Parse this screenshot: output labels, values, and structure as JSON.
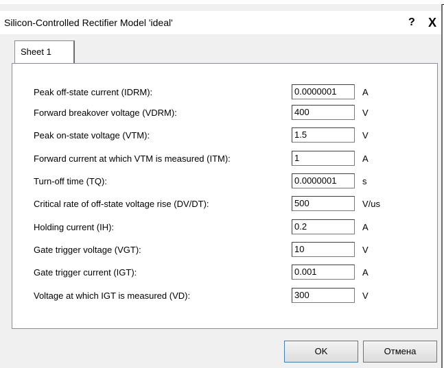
{
  "window": {
    "title": "Silicon-Controlled Rectifier Model 'ideal'",
    "help_label": "?",
    "close_label": "X"
  },
  "tabs": [
    {
      "label": "Sheet 1"
    }
  ],
  "params": [
    {
      "label": "Peak off-state current (IDRM):",
      "value": "0.0000001",
      "unit": "A"
    },
    {
      "label": "Forward breakover voltage (VDRM):",
      "value": "400",
      "unit": "V"
    },
    {
      "label": "Peak on-state voltage (VTM):",
      "value": "1.5",
      "unit": "V"
    },
    {
      "label": "Forward current at which VTM is measured (ITM):",
      "value": "1",
      "unit": "A"
    },
    {
      "label": "Turn-off time (TQ):",
      "value": "0.0000001",
      "unit": "s"
    },
    {
      "label": "Critical rate of off-state voltage rise (DV/DT):",
      "value": "500",
      "unit": "V/us"
    },
    {
      "label": "Holding current (IH):",
      "value": "0.2",
      "unit": "A"
    },
    {
      "label": "Gate trigger voltage (VGT):",
      "value": "10",
      "unit": "V"
    },
    {
      "label": "Gate trigger current (IGT):",
      "value": "0.001",
      "unit": "A"
    },
    {
      "label": "Voltage at which IGT is measured (VD):",
      "value": "300",
      "unit": "V"
    }
  ],
  "buttons": {
    "ok": "OK",
    "cancel": "Отмена"
  }
}
